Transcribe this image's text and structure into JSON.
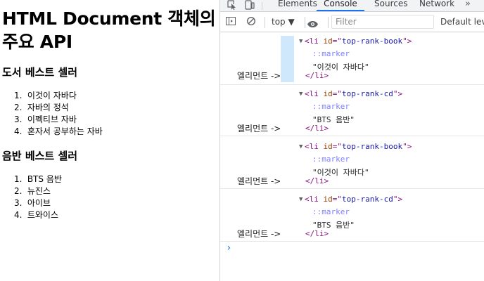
{
  "page": {
    "title": "HTML Document 객체의 주요 API",
    "book_section_title": "도서 베스트 셀러",
    "music_section_title": "음반 베스트 셀러",
    "book_items": [
      {
        "number": "1.",
        "text": "이것이 자바다"
      },
      {
        "number": "2.",
        "text": "자바의 정석"
      },
      {
        "number": "3.",
        "text": "이펙티브 자바"
      },
      {
        "number": "4.",
        "text": "혼자서 공부하는 자바"
      }
    ],
    "music_items": [
      {
        "number": "1.",
        "text": "BTS 음반"
      },
      {
        "number": "2.",
        "text": "뉴진스"
      },
      {
        "number": "3.",
        "text": "아이브"
      },
      {
        "number": "4.",
        "text": "트와이스"
      }
    ]
  },
  "devtools": {
    "tabs": {
      "elements": "Elements",
      "console": "Console",
      "sources": "Sources",
      "network": "Network",
      "more": "»"
    },
    "toolbar": {
      "context": "top ▼",
      "filter_placeholder": "Filter",
      "level": "Default level"
    },
    "console": {
      "entries": [
        {
          "label": "엘리먼트 ->",
          "id": "top-rank-book",
          "marker": "::marker",
          "text": "\"이것이 자바다\"",
          "close": "</li>"
        },
        {
          "label": "엘리먼트 ->",
          "id": "top-rank-cd",
          "marker": "::marker",
          "text": "\"BTS 음반\"",
          "close": "</li>"
        },
        {
          "label": "엘리먼트 ->",
          "id": "top-rank-book",
          "marker": "::marker",
          "text": "\"이것이 자바다\"",
          "close": "</li>"
        },
        {
          "label": "엘리먼트 ->",
          "id": "top-rank-cd",
          "marker": "::marker",
          "text": "\"BTS 음반\"",
          "close": "</li>"
        }
      ],
      "prompt": "›"
    },
    "colors": {
      "accent": "#1a73e8",
      "highlight": "#cfe8fc",
      "tag": "#881280",
      "attribute": "#994500",
      "value": "#1a1aa6",
      "pseudo": "#7f7fff"
    }
  }
}
